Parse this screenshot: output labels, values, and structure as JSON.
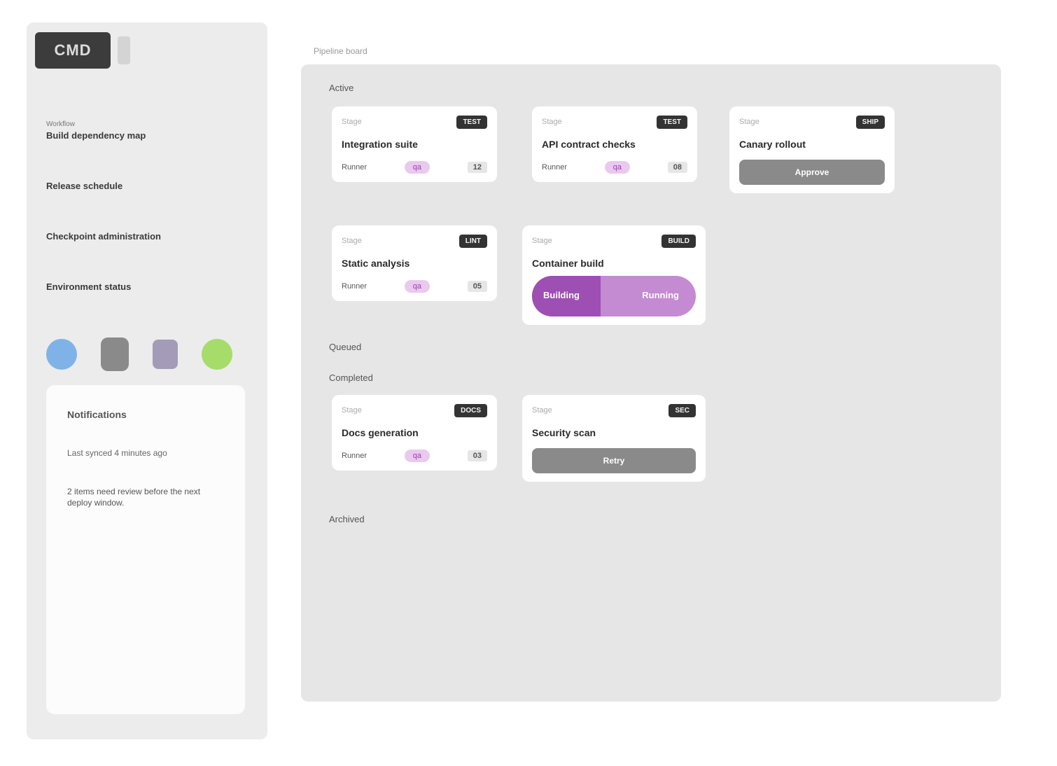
{
  "sidebar": {
    "logo": "CMD",
    "menu": [
      {
        "sub": "Workflow",
        "label": "Build dependency map"
      },
      {
        "label": "Release schedule"
      },
      {
        "label": "Checkpoint administration"
      },
      {
        "label": "Environment status"
      }
    ],
    "avatars": [
      "blue-avatar",
      "gray-avatar",
      "purple-avatar",
      "green-avatar"
    ],
    "info": {
      "title": "Notifications",
      "line": "Last synced 4 minutes ago",
      "body": "2 items need review before the next deploy window."
    }
  },
  "main": {
    "label": "Pipeline board",
    "sections": [
      {
        "label": "Active"
      },
      {
        "label": "Queued"
      },
      {
        "label": "Completed"
      },
      {
        "label": "Archived"
      }
    ],
    "cards": [
      {
        "kicker": "Stage",
        "chip": "TEST",
        "title": "Integration suite",
        "meta_left": "Runner",
        "tag": "qa",
        "value": "12"
      },
      {
        "kicker": "Stage",
        "chip": "TEST",
        "title": "API contract checks",
        "meta_left": "Runner",
        "tag": "qa",
        "value": "08"
      },
      {
        "kicker": "Stage",
        "chip": "SHIP",
        "title": "Canary rollout",
        "button": "Approve"
      },
      {
        "kicker": "Stage",
        "chip": "LINT",
        "title": "Static analysis",
        "meta_left": "Runner",
        "tag": "qa",
        "value": "05"
      },
      {
        "kicker": "Stage",
        "chip": "BUILD",
        "title": "Container build",
        "progress_left": "Building",
        "progress_right": "Running",
        "progress": 0.42
      },
      {
        "kicker": "Stage",
        "chip": "DOCS",
        "title": "Docs generation",
        "meta_left": "Runner",
        "tag": "qa",
        "value": "03"
      },
      {
        "kicker": "Stage",
        "chip": "SEC",
        "title": "Security scan",
        "button": "Retry"
      }
    ]
  },
  "colors": {
    "accent": "#9d4fb3",
    "tag_bg": "#e9c9ee",
    "board": "#e6e6e6"
  }
}
